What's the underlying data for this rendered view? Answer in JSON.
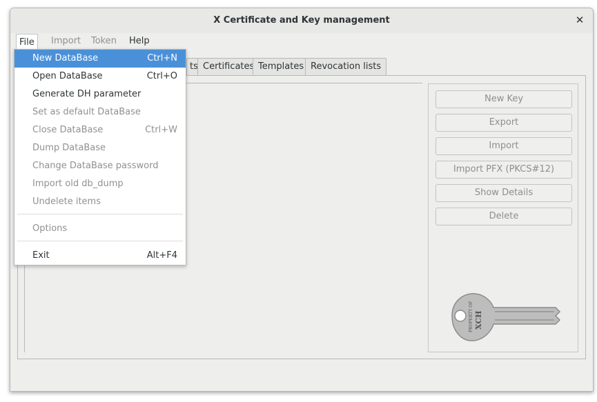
{
  "window": {
    "title": "X Certificate and Key management"
  },
  "menubar": {
    "items": [
      {
        "label": "File",
        "enabled": true,
        "open": true
      },
      {
        "label": "Import",
        "enabled": false
      },
      {
        "label": "Token",
        "enabled": false
      },
      {
        "label": "Help",
        "enabled": true
      }
    ]
  },
  "tabs": [
    {
      "label": "ts"
    },
    {
      "label": "Certificates"
    },
    {
      "label": "Templates"
    },
    {
      "label": "Revocation lists"
    }
  ],
  "file_menu": {
    "items": [
      {
        "label": "New DataBase",
        "shortcut": "Ctrl+N",
        "enabled": true,
        "highlighted": true
      },
      {
        "label": "Open DataBase",
        "shortcut": "Ctrl+O",
        "enabled": true
      },
      {
        "label": "Generate DH parameter",
        "shortcut": "",
        "enabled": true
      },
      {
        "label": "Set as default DataBase",
        "shortcut": "",
        "enabled": false
      },
      {
        "label": "Close DataBase",
        "shortcut": "Ctrl+W",
        "enabled": false
      },
      {
        "label": "Dump DataBase",
        "shortcut": "",
        "enabled": false
      },
      {
        "label": "Change DataBase password",
        "shortcut": "",
        "enabled": false
      },
      {
        "label": "Import old db_dump",
        "shortcut": "",
        "enabled": false
      },
      {
        "label": "Undelete items",
        "shortcut": "",
        "enabled": false
      },
      {
        "label": "Options",
        "shortcut": "",
        "enabled": false
      },
      {
        "label": "Exit",
        "shortcut": "Alt+F4",
        "enabled": true
      }
    ]
  },
  "actions": {
    "new_key": "New Key",
    "export": "Export",
    "import": "Import",
    "import_pfx": "Import PFX (PKCS#12)",
    "show_details": "Show Details",
    "delete": "Delete"
  },
  "logo": {
    "line1": "PROPERTY OF",
    "line2": "XCH"
  },
  "colors": {
    "highlight": "#4a90d9",
    "disabled_text": "#8e9291",
    "window_bg": "#eeeeec"
  }
}
